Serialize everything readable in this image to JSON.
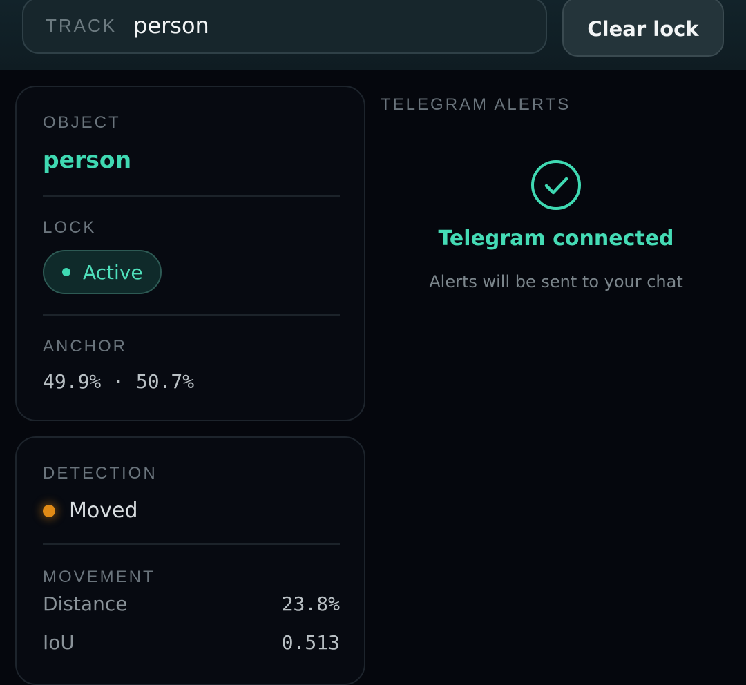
{
  "header": {
    "track_label": "TRACK",
    "track_value": "person",
    "clear_button_label": "Clear lock"
  },
  "status_card": {
    "object_label": "OBJECT",
    "object_value": "person",
    "lock_label": "LOCK",
    "lock_value": "Active",
    "anchor_label": "ANCHOR",
    "anchor_value": "49.9% · 50.7%"
  },
  "detection_card": {
    "detection_label": "DETECTION",
    "detection_value": "Moved",
    "movement_label": "MOVEMENT",
    "metrics": [
      {
        "name": "Distance",
        "value": "23.8%"
      },
      {
        "name": "IoU",
        "value": "0.513"
      }
    ]
  },
  "telegram": {
    "section_title": "TELEGRAM ALERTS",
    "status_icon": "check-circle-icon",
    "status_text": "Telegram connected",
    "subtitle": "Alerts will be sent to your chat"
  },
  "colors": {
    "accent": "#3fd9b2",
    "warning": "#e08a16",
    "background": "#05070d"
  }
}
